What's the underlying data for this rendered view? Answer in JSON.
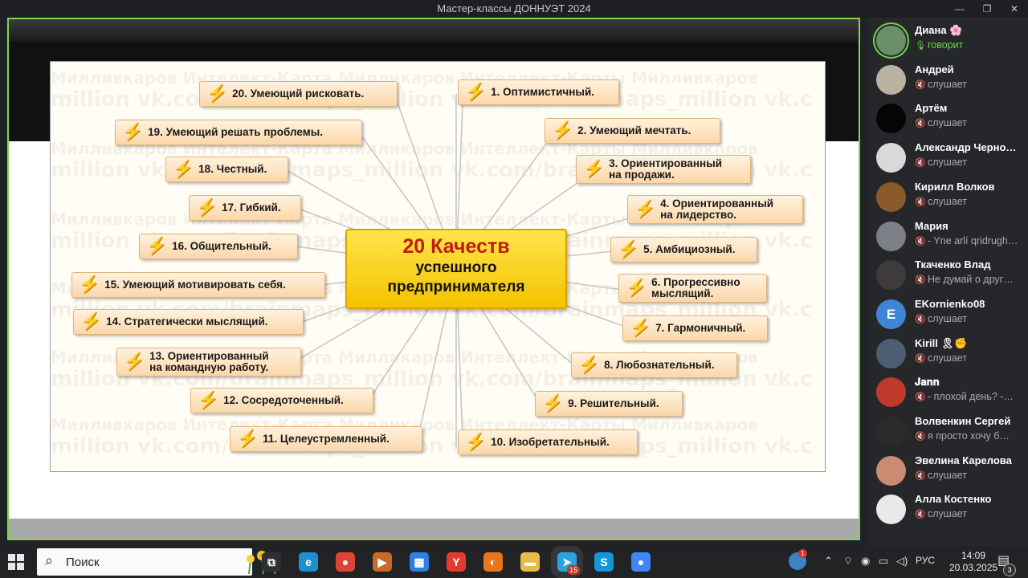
{
  "window": {
    "title": "Мастер-классы ДОННУЭТ 2024",
    "controls": [
      "—",
      "❐",
      "✕"
    ]
  },
  "slide": {
    "watermark_lines": [
      "Милливкаров  Интелект-Карта  Милликаров  Интеллект-Карты  Милливкаров",
      "million  vk.com/brainmaps_million  vk.com/brainmaps_million  vk.c"
    ],
    "center": {
      "line1": "20 Качеств",
      "line2": "успешного",
      "line3": "предпринимателя"
    },
    "qualities": [
      {
        "id": 1,
        "line1": "1. Оптимистичный.",
        "line2": ""
      },
      {
        "id": 2,
        "line1": "2. Умеющий мечтать.",
        "line2": ""
      },
      {
        "id": 3,
        "line1": "3. Ориентированный",
        "line2": "на продажи."
      },
      {
        "id": 4,
        "line1": "4. Ориентированный",
        "line2": "на лидерство."
      },
      {
        "id": 5,
        "line1": "5. Амбициозный.",
        "line2": ""
      },
      {
        "id": 6,
        "line1": "6. Прогрессивно",
        "line2": "мыслящий."
      },
      {
        "id": 7,
        "line1": "7. Гармоничный.",
        "line2": ""
      },
      {
        "id": 8,
        "line1": "8. Любознательный.",
        "line2": ""
      },
      {
        "id": 9,
        "line1": "9. Решительный.",
        "line2": ""
      },
      {
        "id": 10,
        "line1": "10. Изобретательный.",
        "line2": ""
      },
      {
        "id": 11,
        "line1": "11. Целеустремленный.",
        "line2": ""
      },
      {
        "id": 12,
        "line1": "12. Сосредоточенный.",
        "line2": ""
      },
      {
        "id": 13,
        "line1": "13. Ориентированный",
        "line2": "на командную работу."
      },
      {
        "id": 14,
        "line1": "14. Стратегически мыслящий.",
        "line2": ""
      },
      {
        "id": 15,
        "line1": "15. Умеющий мотивировать себя.",
        "line2": ""
      },
      {
        "id": 16,
        "line1": "16. Общительный.",
        "line2": ""
      },
      {
        "id": 17,
        "line1": "17. Гибкий.",
        "line2": ""
      },
      {
        "id": 18,
        "line1": "18. Честный.",
        "line2": ""
      },
      {
        "id": 19,
        "line1": "19. Умеющий решать проблемы.",
        "line2": ""
      },
      {
        "id": 20,
        "line1": "20. Умеющий рисковать.",
        "line2": ""
      }
    ]
  },
  "participants": [
    {
      "name": "Диана 🌸",
      "status": "говорит",
      "speaking": true,
      "avatar_color": "#6b8f6a"
    },
    {
      "name": "Андрей",
      "status": "слушает",
      "speaking": false,
      "avatar_color": "#b9b3a0"
    },
    {
      "name": "Артём",
      "status": "слушает",
      "speaking": false,
      "avatar_color": "#050505"
    },
    {
      "name": "Александр Черно…",
      "status": "слушает",
      "speaking": false,
      "avatar_color": "#d9d9d9"
    },
    {
      "name": "Кирилл Волков",
      "status": "слушает",
      "speaking": false,
      "avatar_color": "#8a5a2b"
    },
    {
      "name": "Мария",
      "status": "- Yne arlí qridrugh…",
      "speaking": false,
      "avatar_color": "#7c7f86"
    },
    {
      "name": "Ткаченко Влад",
      "status": "Не думай о друг…",
      "speaking": false,
      "avatar_color": "#3f3b3a"
    },
    {
      "name": "EKornienko08",
      "status": "слушает",
      "speaking": false,
      "avatar_color": "#3d86d6",
      "initial": "E"
    },
    {
      "name": "Kirill 🎗✊",
      "status": "слушает",
      "speaking": false,
      "avatar_color": "#4d5e74"
    },
    {
      "name": "𝐉𝐚𝐧𝐧",
      "status": "- плохой день? -…",
      "speaking": false,
      "avatar_color": "#c0392b"
    },
    {
      "name": "Волвенкин Сергей",
      "status": "я просто хочу б…",
      "speaking": false,
      "avatar_color": "#2b2b2b"
    },
    {
      "name": "Эвелина Карелова",
      "status": "слушает",
      "speaking": false,
      "avatar_color": "#c98c73"
    },
    {
      "name": "Алла Костенко",
      "status": "слушает",
      "speaking": false,
      "avatar_color": "#e9e9e9"
    }
  ],
  "taskbar": {
    "search_placeholder": "Поиск",
    "apps": [
      {
        "name": "task-view-icon",
        "glyph": "⧉",
        "color": "#2d2f33"
      },
      {
        "name": "edge-icon",
        "glyph": "e",
        "color": "#1f8fcf"
      },
      {
        "name": "chrome-icon",
        "glyph": "●",
        "color": "#db4437"
      },
      {
        "name": "media-icon",
        "glyph": "▶",
        "color": "#c96a2a"
      },
      {
        "name": "store-icon",
        "glyph": "▦",
        "color": "#2f7fe3"
      },
      {
        "name": "yandex-icon",
        "glyph": "Y",
        "color": "#e23b2e"
      },
      {
        "name": "firefox-icon",
        "glyph": "◐",
        "color": "#e8761c"
      },
      {
        "name": "explorer-icon",
        "glyph": "▬",
        "color": "#e9b949"
      },
      {
        "name": "telegram-icon",
        "glyph": "➤",
        "color": "#2aa3dd"
      },
      {
        "name": "skype-icon",
        "glyph": "S",
        "color": "#1596d6"
      },
      {
        "name": "chrome-profile-icon",
        "glyph": "●",
        "color": "#4285f4"
      }
    ],
    "telegram_badge": "15",
    "tray_badge": "1",
    "language": "РУС",
    "time": "14:09",
    "date": "20.03.2025",
    "notifications": "3"
  }
}
